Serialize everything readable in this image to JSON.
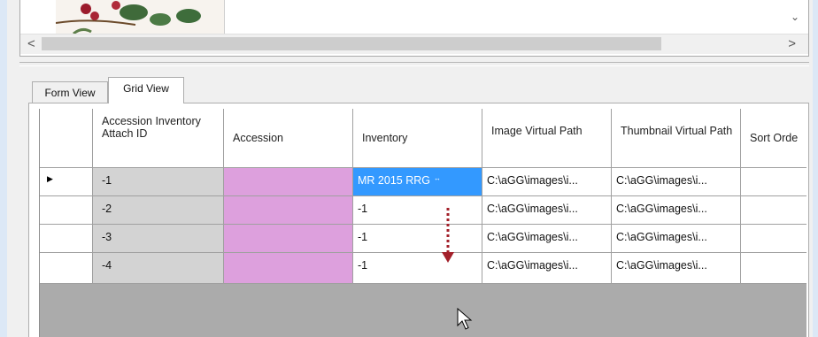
{
  "horizontal_scrollbar": {
    "left_arrow": "<",
    "right_arrow": ">"
  },
  "vertical_scrollbar": {
    "down_arrow": "⌄"
  },
  "tabs": [
    {
      "label": "Form View"
    },
    {
      "label": "Grid View"
    }
  ],
  "grid": {
    "columns": [
      "Accession Inventory Attach ID",
      "Accession",
      "Inventory",
      "Image Virtual Path",
      "Thumbnail Virtual Path",
      "Sort Orde"
    ],
    "current_row_marker": "▶",
    "rows": [
      {
        "id": "-1",
        "inventory": "MR 2015 RRG",
        "image_path": "C:\\aGG\\images\\i...",
        "thumb_path": "C:\\aGG\\images\\i..."
      },
      {
        "id": "-2",
        "inventory": "-1",
        "image_path": "C:\\aGG\\images\\i...",
        "thumb_path": "C:\\aGG\\images\\i..."
      },
      {
        "id": "-3",
        "inventory": "-1",
        "image_path": "C:\\aGG\\images\\i...",
        "thumb_path": "C:\\aGG\\images\\i..."
      },
      {
        "id": "-4",
        "inventory": "-1",
        "image_path": "C:\\aGG\\images\\i...",
        "thumb_path": "C:\\aGG\\images\\i..."
      }
    ],
    "selected_cell_icon": "↔"
  },
  "colors": {
    "accession_cell": "#dda0dd",
    "selected_cell": "#3399ff",
    "id_cell": "#d3d3d3",
    "grid_background": "#ababab",
    "annotation_arrow": "#a3202a"
  },
  "icons": [
    "plant-thumbnail",
    "scroll-left-icon",
    "scroll-right-icon",
    "scroll-down-icon",
    "row-indicator-icon",
    "pin-icon",
    "drag-down-arrow",
    "mouse-cursor-icon"
  ]
}
